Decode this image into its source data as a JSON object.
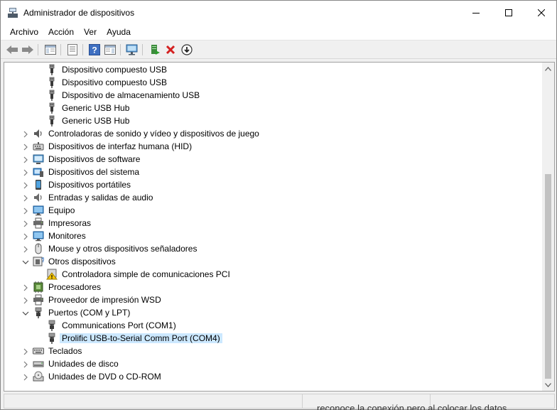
{
  "window": {
    "title": "Administrador de dispositivos"
  },
  "menu": [
    "Archivo",
    "Acción",
    "Ver",
    "Ayuda"
  ],
  "toolbar": {
    "buttons": [
      "back-icon",
      "forward-icon",
      "show-hide-console-tree-icon",
      "properties-icon",
      "help-icon",
      "action-pane-icon",
      "scan-hardware-icon",
      "update-driver-icon",
      "uninstall-device-icon",
      "disable-device-icon"
    ]
  },
  "tree": {
    "items": [
      {
        "label": "Dispositivo compuesto USB",
        "level": 2,
        "icon": "usb-icon",
        "expander": "none"
      },
      {
        "label": "Dispositivo compuesto USB",
        "level": 2,
        "icon": "usb-icon",
        "expander": "none"
      },
      {
        "label": "Dispositivo de almacenamiento USB",
        "level": 2,
        "icon": "usb-icon",
        "expander": "none"
      },
      {
        "label": "Generic USB Hub",
        "level": 2,
        "icon": "usb-icon",
        "expander": "none"
      },
      {
        "label": "Generic USB Hub",
        "level": 2,
        "icon": "usb-icon",
        "expander": "none"
      },
      {
        "label": "Controladoras de sonido y vídeo y dispositivos de juego",
        "level": 1,
        "icon": "speaker-icon",
        "expander": "collapsed"
      },
      {
        "label": "Dispositivos de interfaz humana (HID)",
        "level": 1,
        "icon": "hid-icon",
        "expander": "collapsed"
      },
      {
        "label": "Dispositivos de software",
        "level": 1,
        "icon": "software-device-icon",
        "expander": "collapsed"
      },
      {
        "label": "Dispositivos del sistema",
        "level": 1,
        "icon": "system-device-icon",
        "expander": "collapsed"
      },
      {
        "label": "Dispositivos portátiles",
        "level": 1,
        "icon": "portable-device-icon",
        "expander": "collapsed"
      },
      {
        "label": "Entradas y salidas de audio",
        "level": 1,
        "icon": "audio-io-icon",
        "expander": "collapsed"
      },
      {
        "label": "Equipo",
        "level": 1,
        "icon": "computer-icon",
        "expander": "collapsed"
      },
      {
        "label": "Impresoras",
        "level": 1,
        "icon": "printer-icon",
        "expander": "collapsed"
      },
      {
        "label": "Monitores",
        "level": 1,
        "icon": "monitor-icon",
        "expander": "collapsed"
      },
      {
        "label": "Mouse y otros dispositivos señaladores",
        "level": 1,
        "icon": "mouse-icon",
        "expander": "collapsed"
      },
      {
        "label": "Otros dispositivos",
        "level": 1,
        "icon": "unknown-device-icon",
        "expander": "expanded"
      },
      {
        "label": "Controladora simple de comunicaciones PCI",
        "level": 2,
        "icon": "warning-device-icon",
        "expander": "none"
      },
      {
        "label": "Procesadores",
        "level": 1,
        "icon": "processor-icon",
        "expander": "collapsed"
      },
      {
        "label": "Proveedor de impresión WSD",
        "level": 1,
        "icon": "printer-icon",
        "expander": "collapsed"
      },
      {
        "label": "Puertos (COM y LPT)",
        "level": 1,
        "icon": "port-icon",
        "expander": "expanded"
      },
      {
        "label": "Communications Port (COM1)",
        "level": 2,
        "icon": "port-icon",
        "expander": "none"
      },
      {
        "label": "Prolific USB-to-Serial Comm Port (COM4)",
        "level": 2,
        "icon": "port-icon",
        "expander": "none",
        "selected": true
      },
      {
        "label": "Teclados",
        "level": 1,
        "icon": "keyboard-icon",
        "expander": "collapsed"
      },
      {
        "label": "Unidades de disco",
        "level": 1,
        "icon": "disk-drive-icon",
        "expander": "collapsed"
      },
      {
        "label": "Unidades de DVD o CD-ROM",
        "level": 1,
        "icon": "dvd-drive-icon",
        "expander": "collapsed"
      }
    ]
  },
  "background_text": "reconoce la conexión pero al colocar los datos"
}
